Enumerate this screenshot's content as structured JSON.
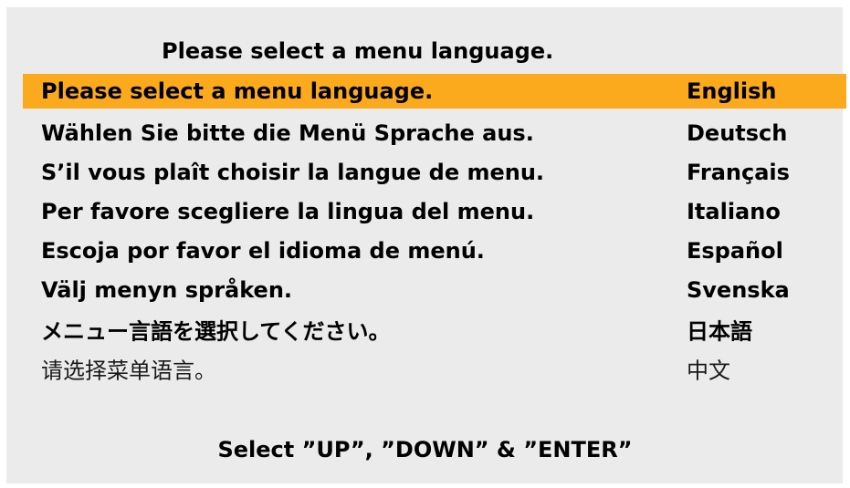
{
  "header": {
    "title": "Please select a menu language."
  },
  "languages": [
    {
      "prompt": "Please select a menu language.",
      "name": "English",
      "selected": true
    },
    {
      "prompt": "Wählen Sie bitte die Menü Sprache aus.",
      "name": "Deutsch",
      "selected": false
    },
    {
      "prompt": "S’il vous plaît choisir la langue de menu.",
      "name": "Français",
      "selected": false
    },
    {
      "prompt": "Per favore scegliere la lingua del menu.",
      "name": "Italiano",
      "selected": false
    },
    {
      "prompt": "Escoja por favor el idioma de menú.",
      "name": "Español",
      "selected": false
    },
    {
      "prompt": "Välj menyn språken.",
      "name": "Svenska",
      "selected": false
    },
    {
      "prompt": "メニュー言語を選択してください。",
      "name": "日本語",
      "selected": false
    },
    {
      "prompt": "请选择菜单语言。",
      "name": "中文",
      "selected": false
    }
  ],
  "footer": {
    "instructions": "Select ”UP”, ”DOWN” & ”ENTER”"
  },
  "colors": {
    "highlight": "#fbaa1e",
    "panel_background": "#ebebeb",
    "text": "#000000"
  }
}
